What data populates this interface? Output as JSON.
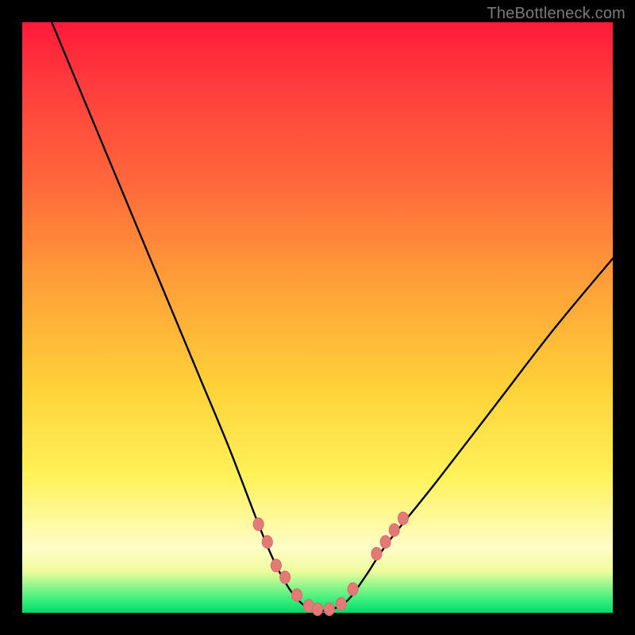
{
  "watermark": {
    "text": "TheBottleneck.com"
  },
  "colors": {
    "page_bg": "#000000",
    "curve": "#000000",
    "marker_fill": "#e37a78",
    "marker_stroke": "#d96a68",
    "gradient_stops": [
      "#ff1a3a",
      "#ff6a3a",
      "#ffa238",
      "#ffd238",
      "#fff25a",
      "#fffdc8",
      "#32ef7a"
    ]
  },
  "chart_data": {
    "type": "line",
    "title": "",
    "xlabel": "",
    "ylabel": "",
    "xlim": [
      0,
      100
    ],
    "ylim": [
      0,
      100
    ],
    "grid": false,
    "legend": false,
    "note": "Values are percentages of the plot area (0 = left/bottom, 100 = right/top). Curve descends from top-left, bottoms out near x≈50, rises to the right.",
    "series": [
      {
        "name": "bottleneck-curve",
        "x": [
          5,
          10,
          15,
          20,
          25,
          30,
          35,
          40,
          43,
          46,
          49,
          52,
          55,
          58,
          62,
          70,
          80,
          90,
          100
        ],
        "y": [
          100,
          88,
          76,
          64,
          52,
          40,
          28,
          15,
          8,
          3,
          0.5,
          0.5,
          2,
          6,
          12,
          22,
          35,
          48,
          60
        ]
      }
    ],
    "markers": {
      "name": "highlight-dots",
      "x": [
        40,
        41.5,
        43,
        44.5,
        46.5,
        48.5,
        50,
        52,
        54,
        56,
        60,
        61.5,
        63,
        64.5
      ],
      "y": [
        15,
        12,
        8,
        6,
        3,
        1.2,
        0.6,
        0.6,
        1.5,
        4,
        10,
        12,
        14,
        16
      ]
    }
  }
}
